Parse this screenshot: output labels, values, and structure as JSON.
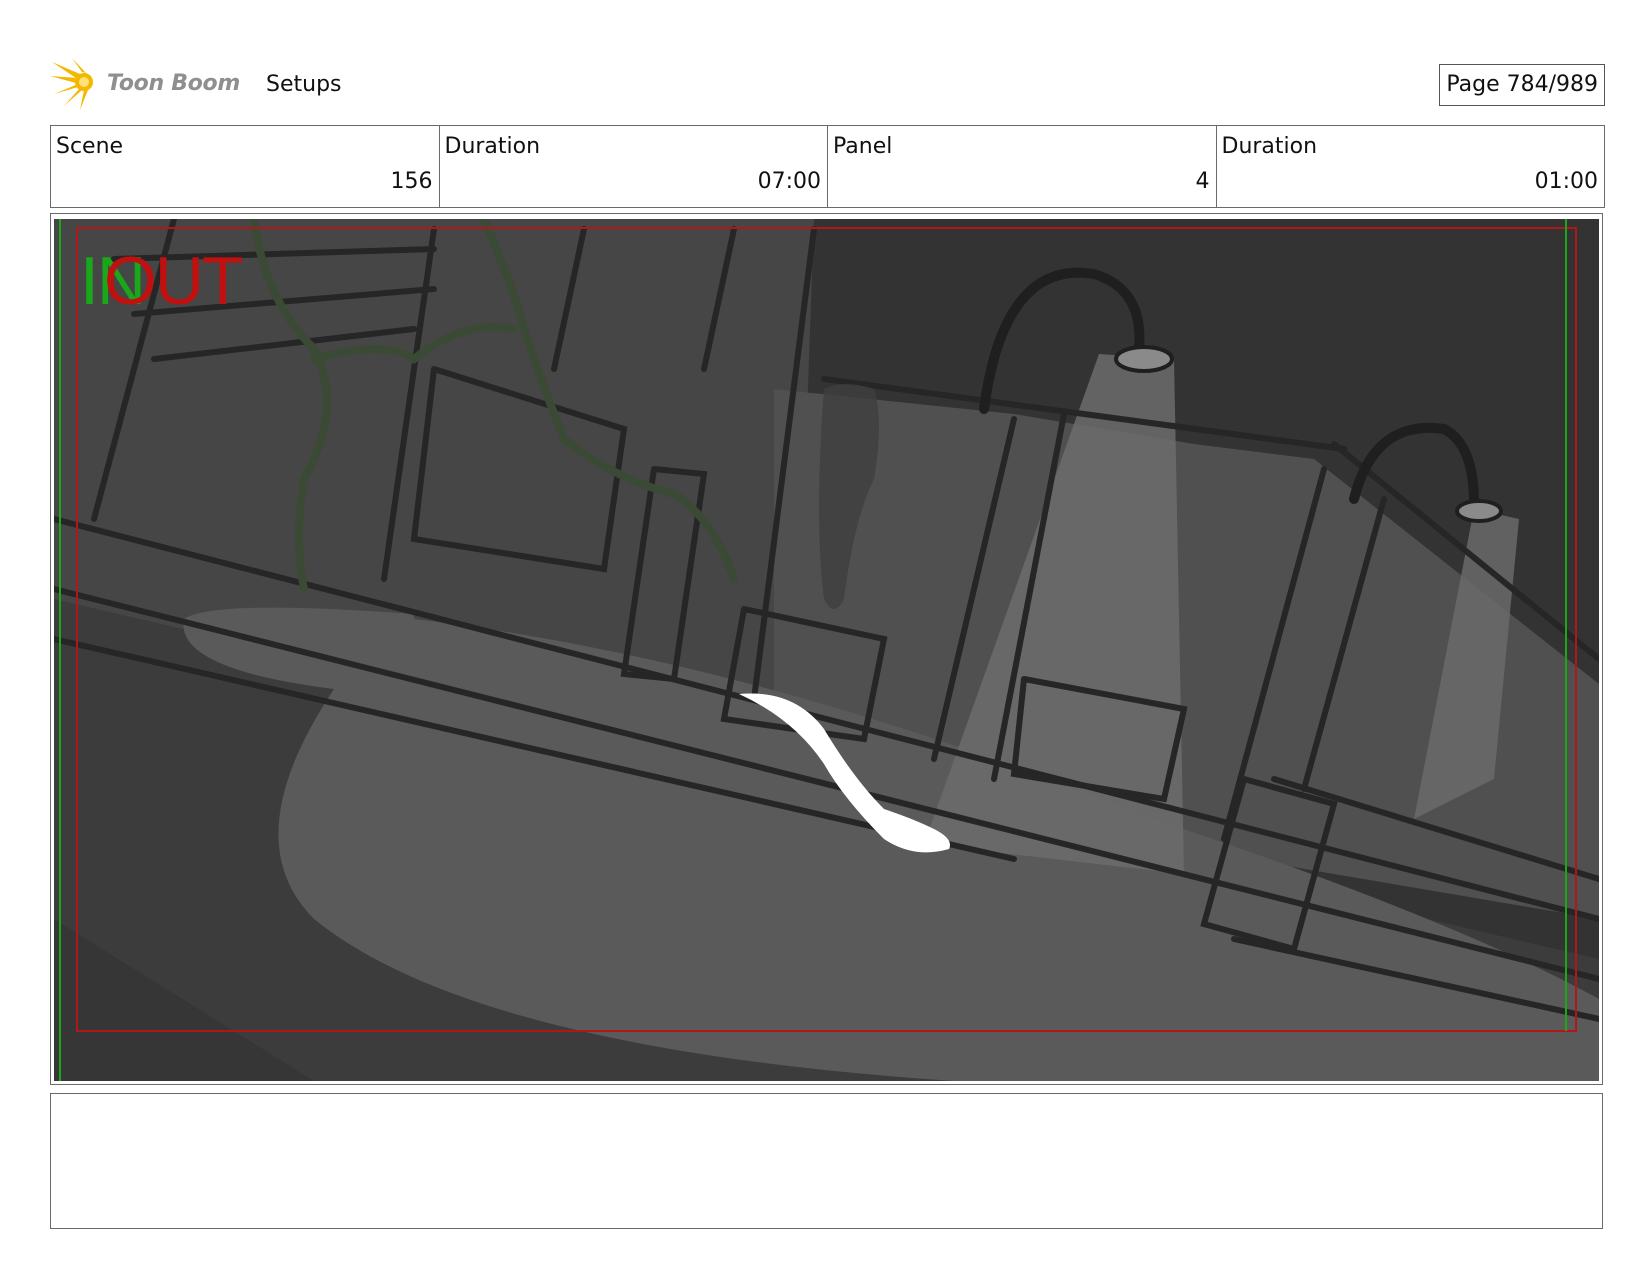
{
  "header": {
    "logo_text": "Toon Boom",
    "title": "Setups",
    "page_label": "Page 784/989"
  },
  "info": {
    "scene_label": "Scene",
    "scene_value": "156",
    "scene_duration_label": "Duration",
    "scene_duration_value": "07:00",
    "panel_label": "Panel",
    "panel_value": "4",
    "panel_duration_label": "Duration",
    "panel_duration_value": "01:00"
  },
  "overlay": {
    "in_label": "IN",
    "out_label": "OUT"
  },
  "notes": {
    "text": ""
  },
  "colors": {
    "in_marker": "#1aa81a",
    "out_marker": "#c01010",
    "frame_border": "#6a6a6a"
  },
  "icons": [
    "toon-boom-logo-icon"
  ]
}
